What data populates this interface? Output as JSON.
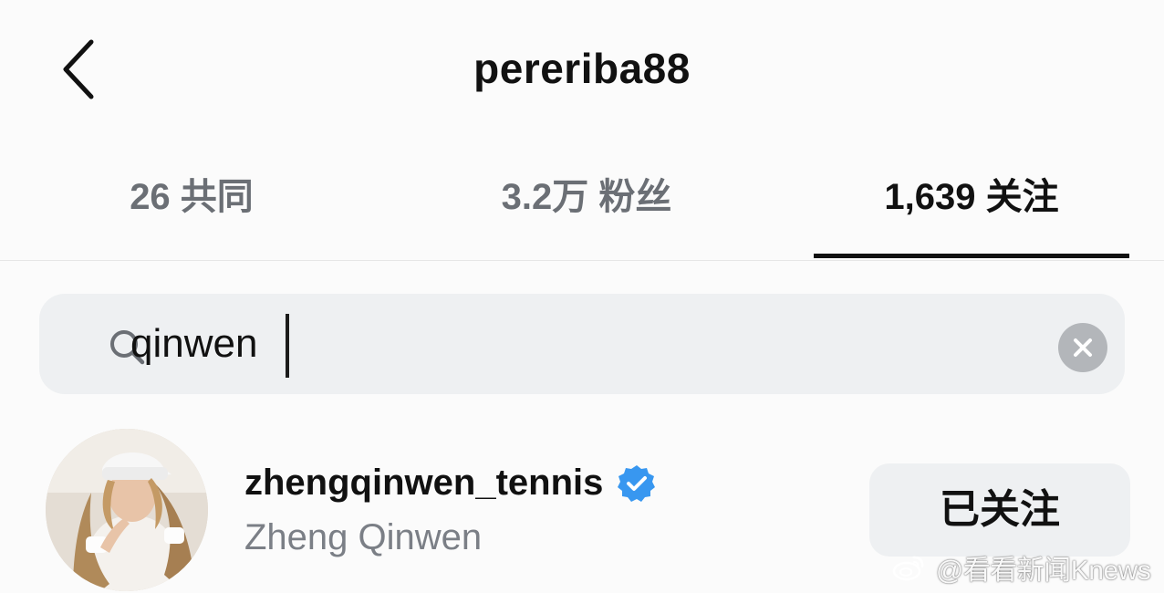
{
  "header": {
    "title": "pereriba88",
    "back_icon": "chevron-left-icon"
  },
  "tabs": [
    {
      "label": "26 共同",
      "active": false
    },
    {
      "label": "3.2万 粉丝",
      "active": false
    },
    {
      "label": "1,639 关注",
      "active": true
    }
  ],
  "search": {
    "value": "qinwen",
    "icon": "search-icon",
    "clear_icon": "clear-icon"
  },
  "results": [
    {
      "username": "zhengqinwen_tennis",
      "full_name": "Zheng Qinwen",
      "verified": true,
      "verified_color": "#3897f0",
      "follow_label": "已关注"
    }
  ],
  "watermark": {
    "text": "@看看新闻Knews"
  }
}
